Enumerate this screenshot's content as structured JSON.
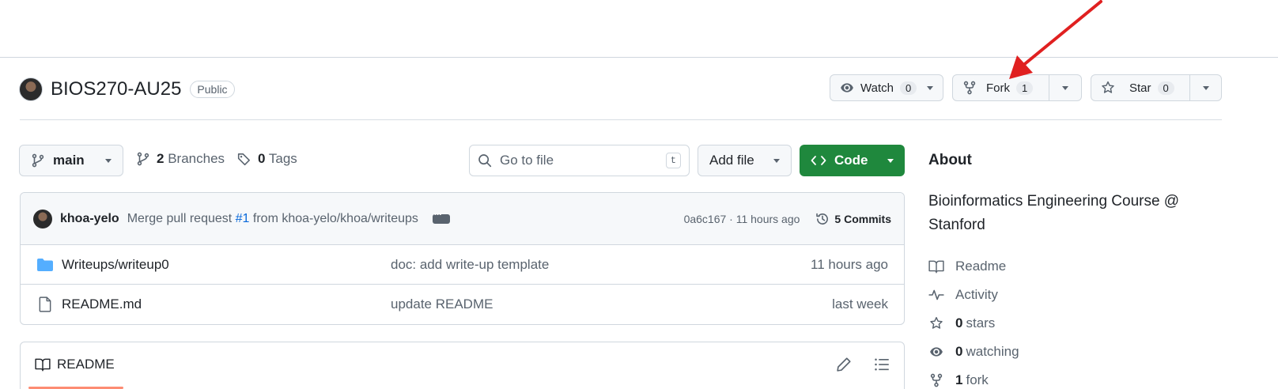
{
  "repo": {
    "name": "BIOS270-AU25",
    "visibility": "Public"
  },
  "actions": {
    "watch": {
      "label": "Watch",
      "count": "0"
    },
    "fork": {
      "label": "Fork",
      "count": "1"
    },
    "star": {
      "label": "Star",
      "count": "0"
    }
  },
  "toolbar": {
    "branch": "main",
    "branches_count": "2",
    "branches_label": "Branches",
    "tags_count": "0",
    "tags_label": "Tags",
    "search_placeholder": "Go to file",
    "search_shortcut": "t",
    "add_file_label": "Add file",
    "code_label": "Code"
  },
  "latest_commit": {
    "author": "khoa-yelo",
    "message_prefix": "Merge pull request",
    "pr_link": "#1",
    "message_suffix": "from khoa-yelo/khoa/writeups",
    "meta": "0a6c167 · 11 hours ago",
    "commits_count": "5 Commits"
  },
  "files": [
    {
      "name": "Writeups/writeup0",
      "type": "folder",
      "commit": "doc: add write-up template",
      "time": "11 hours ago"
    },
    {
      "name": "README.md",
      "type": "file",
      "commit": "update README",
      "time": "last week"
    }
  ],
  "readme": {
    "tab_label": "README"
  },
  "about": {
    "title": "About",
    "description": "Bioinformatics Engineering Course @ Stanford",
    "readme": "Readme",
    "activity": "Activity",
    "stars_count": "0",
    "stars_label": "stars",
    "watching_count": "0",
    "watching_label": "watching",
    "forks_count": "1",
    "forks_label": "fork"
  },
  "colors": {
    "accent_green": "#1f883d",
    "link_blue": "#0969da",
    "annotation_arrow": "#e02020",
    "readme_tab_underline": "#fd8c73"
  },
  "icons": [
    "eye-icon",
    "fork-icon",
    "star-icon",
    "branch-icon",
    "tag-icon",
    "search-icon",
    "code-icon",
    "history-icon",
    "folder-icon",
    "file-icon",
    "book-icon",
    "pencil-icon",
    "list-icon",
    "pulse-icon"
  ]
}
